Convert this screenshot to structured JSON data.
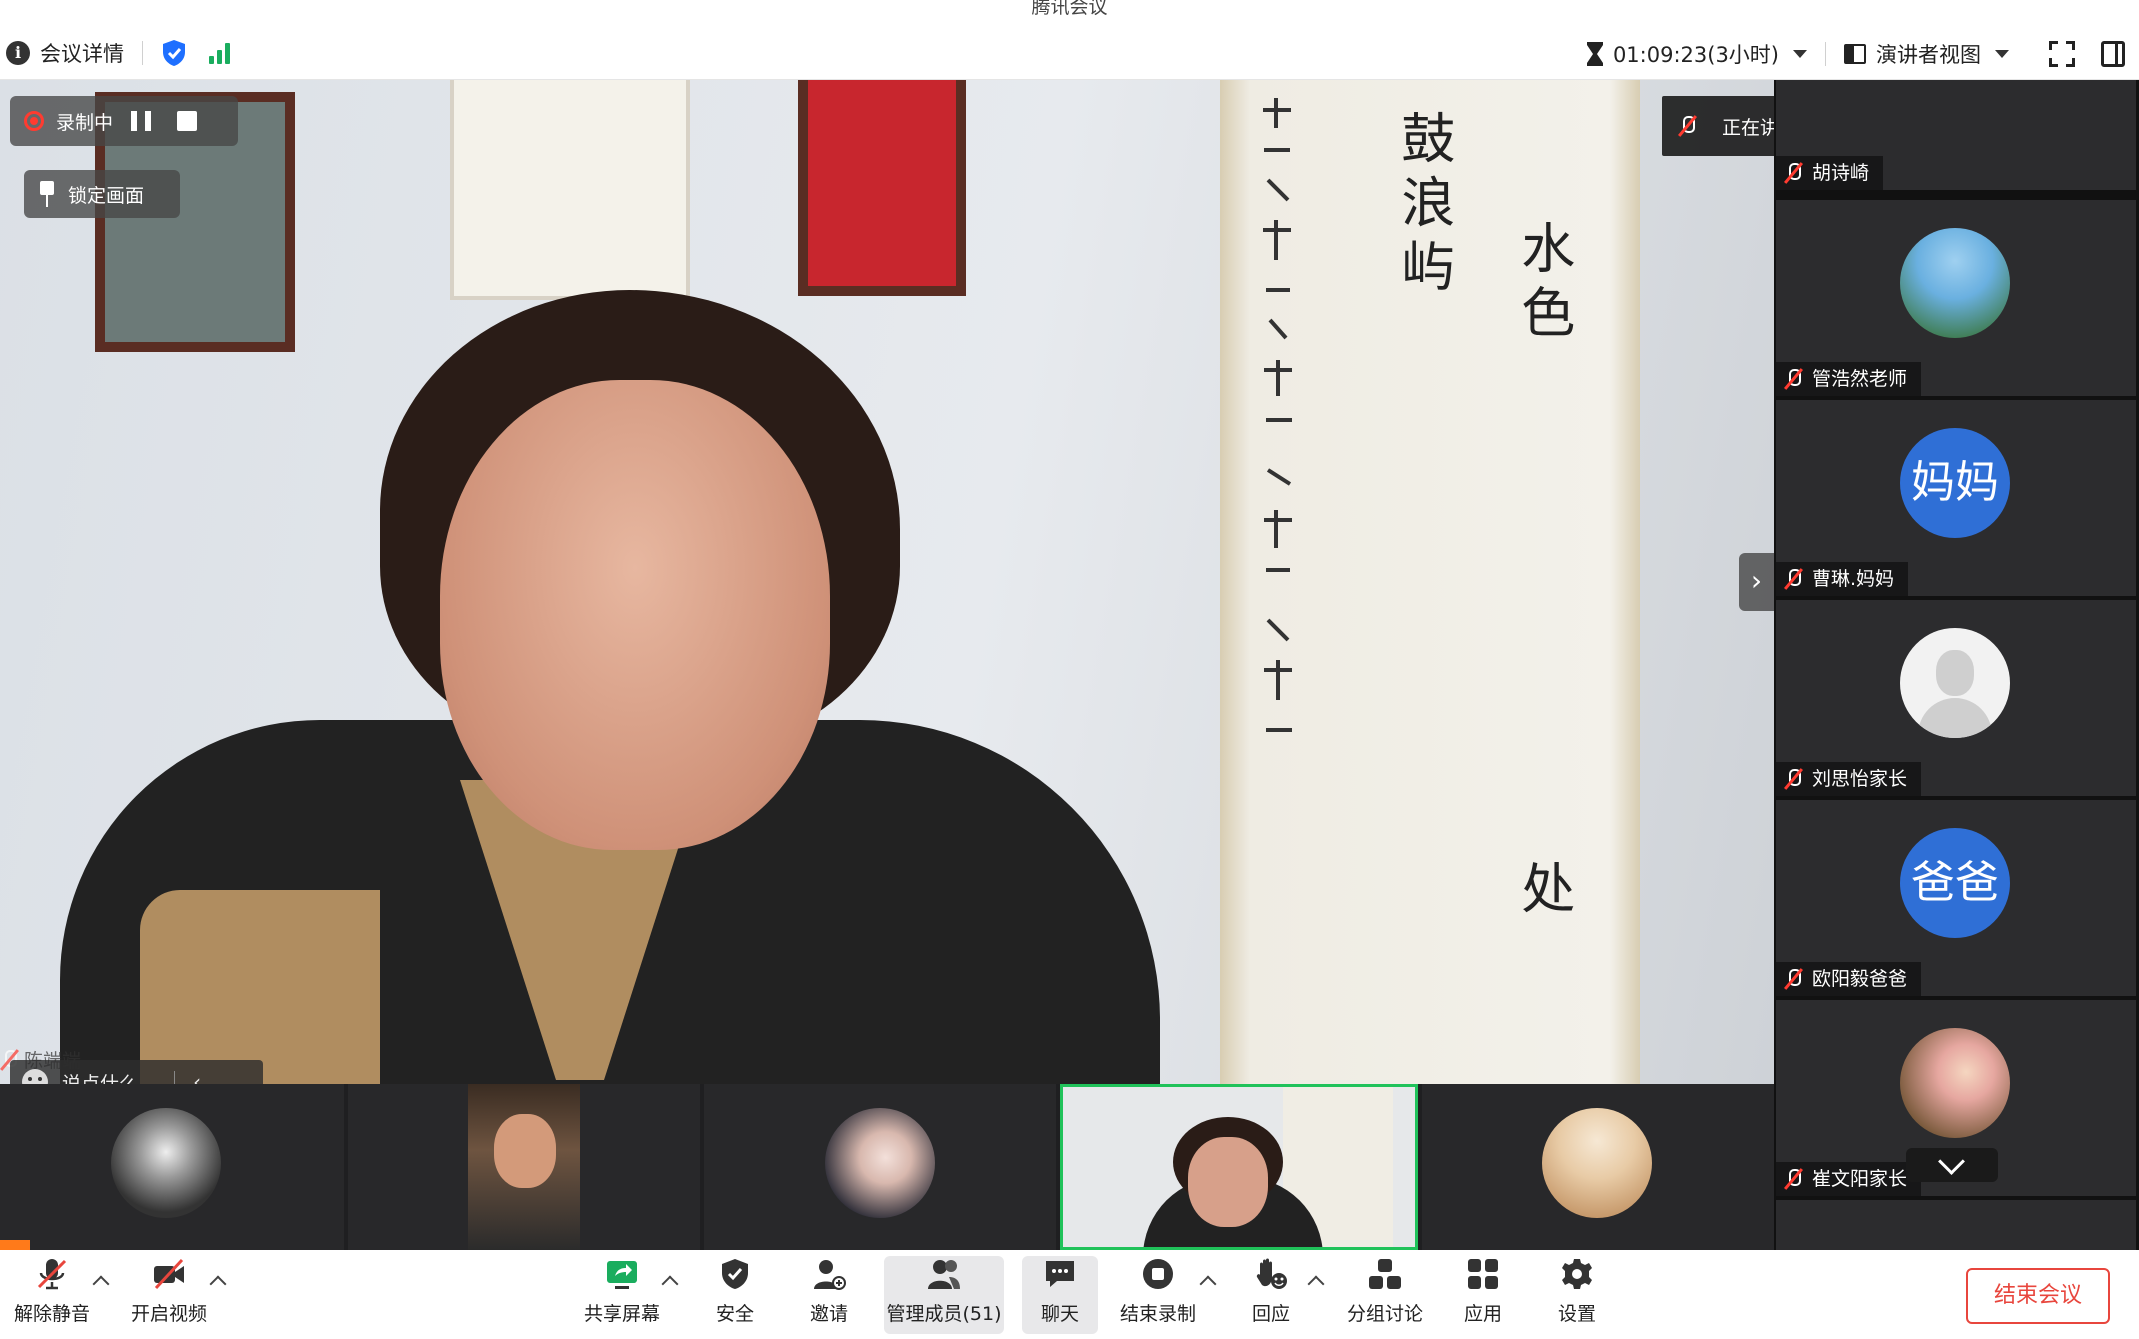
{
  "window": {
    "title": "腾讯会议"
  },
  "topbar": {
    "info_label": "会议详情",
    "timer": "01:09:23(3小时)",
    "view_label": "演讲者视图"
  },
  "recording": {
    "label": "录制中",
    "lock_label": "锁定画面"
  },
  "talking": {
    "label": "正在讲话:  陈端端; 胡亦帅(康..."
  },
  "main": {
    "speaker_name": "陈端端",
    "chat_placeholder": "说点什么...",
    "calligraphy": [
      "鼓浪屿",
      "水色",
      "处"
    ]
  },
  "sidebar": {
    "participants": [
      {
        "name": "胡诗崎",
        "avatar": "photo"
      },
      {
        "name": "管浩然老师",
        "avatar": "photo-outdoor"
      },
      {
        "name": "曹琳.妈妈",
        "avatar": "text",
        "avatar_text": "妈妈"
      },
      {
        "name": "刘思怡家长",
        "avatar": "default-person"
      },
      {
        "name": "欧阳毅爸爸",
        "avatar": "text",
        "avatar_text": "爸爸"
      },
      {
        "name": "崔文阳家长",
        "avatar": "photo-flowers"
      }
    ]
  },
  "toolbar": {
    "unmute": "解除静音",
    "start_video": "开启视频",
    "share_screen": "共享屏幕",
    "security": "安全",
    "invite": "邀请",
    "manage_members": "管理成员(51)",
    "chat": "聊天",
    "end_recording": "结束录制",
    "reactions": "回应",
    "breakout": "分组讨论",
    "apps": "应用",
    "settings": "设置",
    "end_meeting": "结束会议"
  },
  "colors": {
    "accent_green": "#20c25a",
    "end_red": "#e8463d",
    "avatar_blue": "#2f6fd6",
    "rec_red": "#ff3b30"
  }
}
